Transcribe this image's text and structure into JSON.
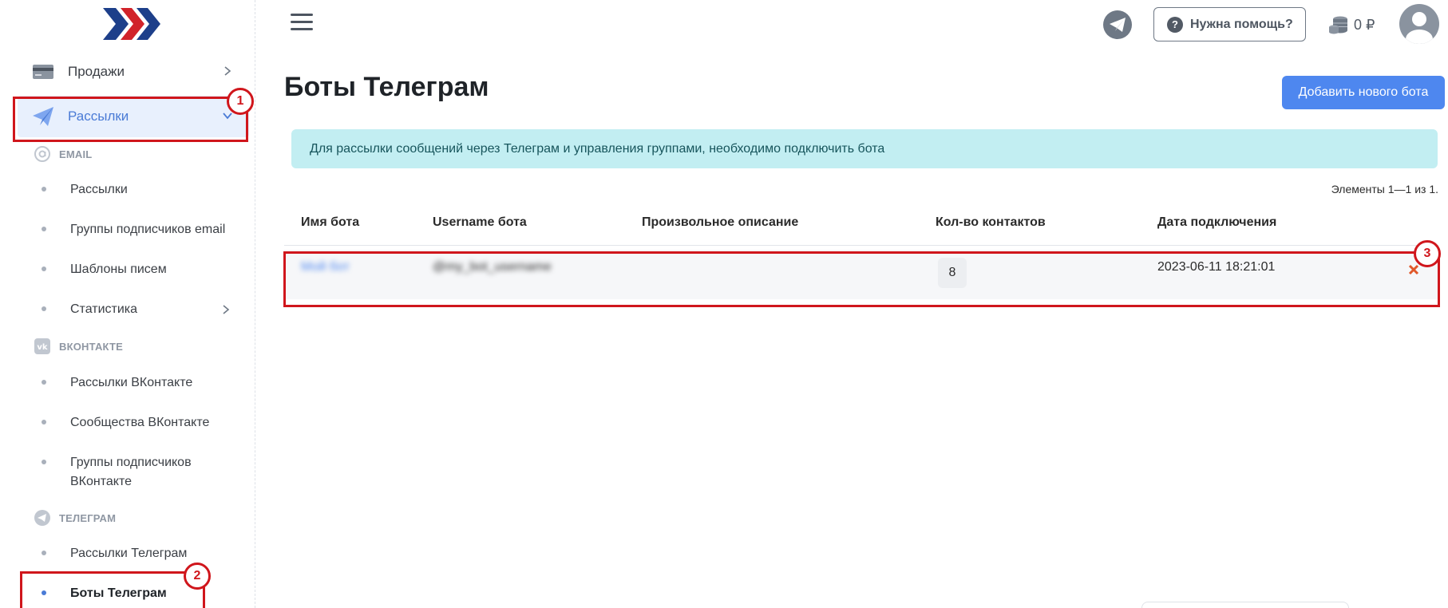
{
  "sidebar": {
    "main_items": [
      {
        "label": "Продажи",
        "icon": "card-icon"
      },
      {
        "label": "Рассылки",
        "icon": "paper-plane-icon"
      }
    ],
    "sections": [
      {
        "title": "EMAIL",
        "icon": "at-icon",
        "items": [
          "Рассылки",
          "Группы подписчиков email",
          "Шаблоны писем",
          "Статистика"
        ]
      },
      {
        "title": "ВКОНТАКТЕ",
        "icon": "vk-icon",
        "items": [
          "Рассылки ВКонтакте",
          "Сообщества ВКонтакте",
          "Группы подписчиков ВКонтакте"
        ]
      },
      {
        "title": "ТЕЛЕГРАМ",
        "icon": "telegram-icon",
        "items": [
          "Рассылки Телеграм",
          "Боты Телеграм"
        ]
      }
    ]
  },
  "topbar": {
    "help_label": "Нужна помощь?",
    "balance": "0 ₽"
  },
  "main": {
    "title": "Боты Телеграм",
    "add_button": "Добавить нового бота",
    "info_message": "Для рассылки сообщений через Телеграм и управления группами, необходимо подключить бота",
    "items_count": "Элементы 1—1 из 1.",
    "table": {
      "columns": [
        "Имя бота",
        "Username бота",
        "Произвольное описание",
        "Кол-во контактов",
        "Дата подключения"
      ],
      "rows": [
        {
          "name": "Мой бот",
          "username": "@my_bot_username",
          "description": "",
          "contacts": "8",
          "date": "2023-06-11 18:21:01"
        }
      ]
    }
  },
  "annotations": [
    "1",
    "2",
    "3"
  ],
  "colors": {
    "accent": "#4e87ef",
    "active_bg": "#e8f0fd",
    "annotation": "#d0161c",
    "alert_bg": "#c2eef2"
  }
}
